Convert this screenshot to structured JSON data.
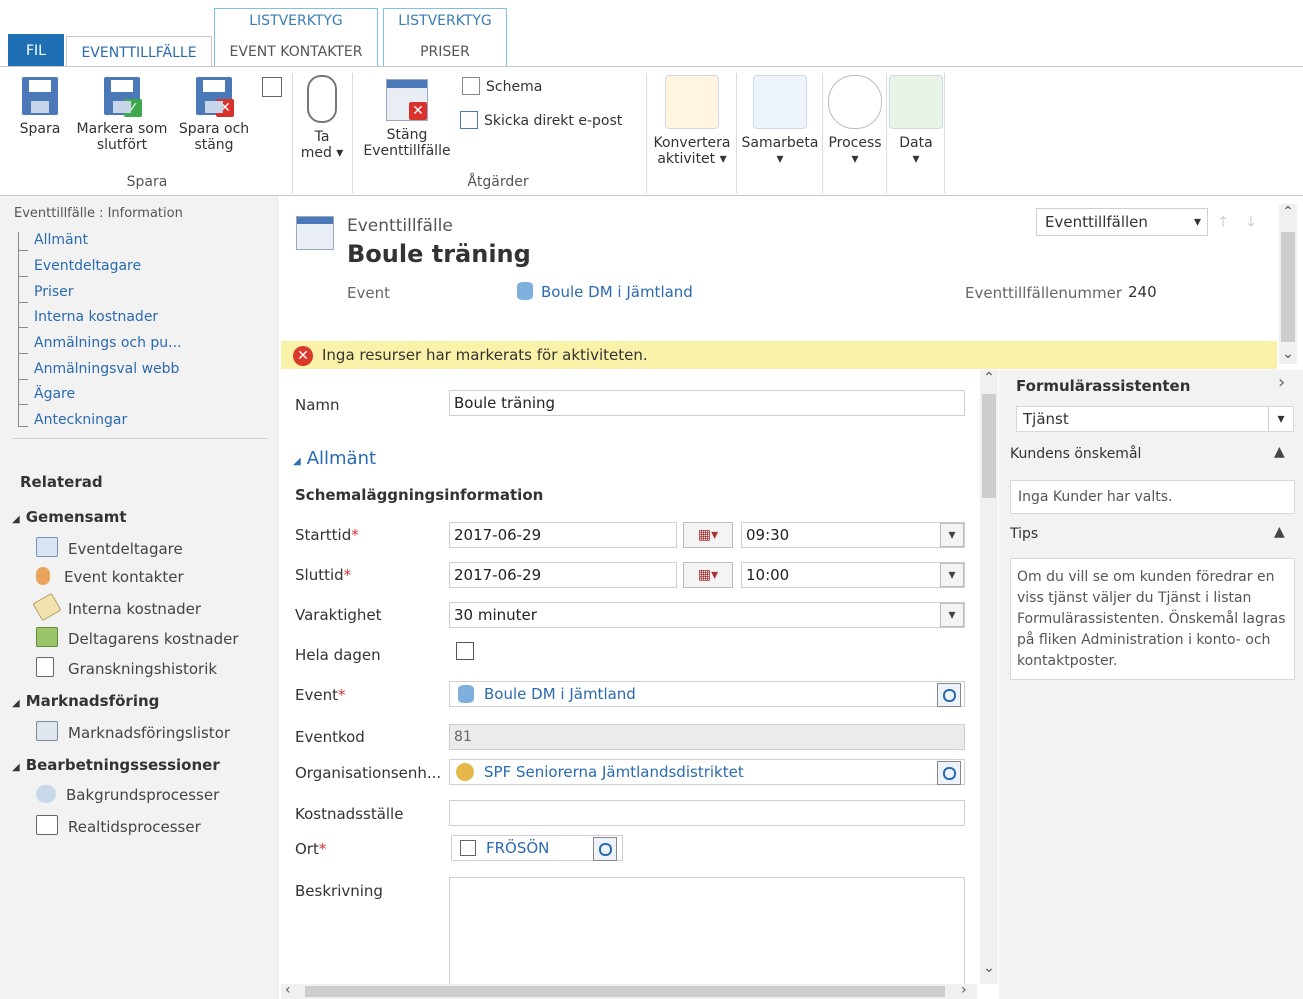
{
  "ribbon_tabs": {
    "fil": "FIL",
    "active": "EVENTTILLFÄLLE",
    "context1_title": "LISTVERKTYG",
    "context1_tab": "EVENT KONTAKTER",
    "context2_title": "LISTVERKTYG",
    "context2_tab": "PRISER"
  },
  "ribbon": {
    "spara": "Spara",
    "markera_line1": "Markera som",
    "markera_line2": "slutfört",
    "spara_och_line1": "Spara och",
    "spara_och_line2": "stäng",
    "group_spara": "Spara",
    "ta_med_line1": "Ta",
    "ta_med_line2": "med",
    "stang_line1": "Stäng",
    "stang_line2": "Eventtillfälle",
    "schema": "Schema",
    "skicka": "Skicka direkt e-post",
    "group_atgarder": "Åtgärder",
    "konvertera_line1": "Konvertera",
    "konvertera_line2": "aktivitet",
    "samarbeta": "Samarbeta",
    "process": "Process",
    "data": "Data",
    "dropdown_glyph": "▾"
  },
  "leftnav": {
    "header": "Eventtillfälle : Information",
    "links": [
      "Allmänt",
      "Eventdeltagare",
      "Priser",
      "Interna kostnader",
      "Anmälnings och pu...",
      "Anmälningsval webb",
      "Ägare",
      "Anteckningar"
    ],
    "related": "Relaterad",
    "gemensamt": "Gemensamt",
    "gemensamt_items": [
      "Eventdeltagare",
      "Event kontakter",
      "Interna kostnader",
      "Deltagarens kostnader",
      "Granskningshistorik"
    ],
    "marknadsforing": "Marknadsföring",
    "marknadsforing_items": [
      "Marknadsföringslistor"
    ],
    "bearbetning": "Bearbetningssessioner",
    "bearbetning_items": [
      "Bakgrundsprocesser",
      "Realtidsprocesser"
    ],
    "collapse_glyph": "◢"
  },
  "header": {
    "entity": "Eventtillfälle",
    "title": "Boule träning",
    "event_label": "Event",
    "event_value": "Boule DM i Jämtland",
    "number_label": "Eventtillfällenummer",
    "number_value": "240",
    "view_select": "Eventtillfällen",
    "up_arrow": "🡑",
    "down_arrow": "🡓"
  },
  "notice": {
    "icon": "✕",
    "text": "Inga resurser har markerats för aktiviteten."
  },
  "form": {
    "namn_label": "Namn",
    "namn_value": "Boule träning",
    "section_allmant": "Allmänt",
    "section_glyph": "◢",
    "schema_heading": "Schemaläggningsinformation",
    "starttid_label": "Starttid",
    "starttid_date": "2017-06-29",
    "starttid_time": "09:30",
    "sluttid_label": "Sluttid",
    "sluttid_date": "2017-06-29",
    "sluttid_time": "10:00",
    "varaktighet_label": "Varaktighet",
    "varaktighet_value": "30 minuter",
    "hela_dagen_label": "Hela dagen",
    "event_label": "Event",
    "event_value": "Boule DM i Jämtland",
    "eventkod_label": "Eventkod",
    "eventkod_value": "81",
    "org_label": "Organisationsenh...",
    "org_value": "SPF Seniorerna Jämtlandsdistriktet",
    "kostnad_label": "Kostnadsställe",
    "kostnad_value": "",
    "ort_label": "Ort",
    "ort_value": "FRÖSÖN",
    "beskrivning_label": "Beskrivning",
    "required_mark": "*",
    "dd_glyph": "▾",
    "cal_glyph": "▦▾"
  },
  "rightpanel": {
    "title": "Formulärassistenten",
    "select_value": "Tjänst",
    "kundens_label": "Kundens önskemål",
    "kundens_text": "Inga Kunder har valts.",
    "tips_label": "Tips",
    "tips_text": "Om du vill se om kunden föredrar en viss tjänst väljer du Tjänst i listan Formulärassistenten. Önskemål lagras på fliken Administration i konto- och kontaktposter.",
    "collapse_glyph": "▲",
    "expand_glyph": "›"
  },
  "scroll": {
    "up": "⌃",
    "down": "⌄",
    "left": "‹",
    "right": "›"
  }
}
